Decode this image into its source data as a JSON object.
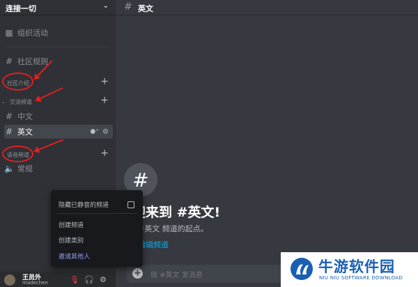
{
  "server": {
    "name": "连接一切"
  },
  "sidebar": {
    "events_label": "组织活动",
    "rules_channel": "社区规则",
    "categories": {
      "community": "社区介绍",
      "chat": "交流频道",
      "voice": "语音频道"
    },
    "chat_channels": [
      "中文",
      "英文"
    ],
    "voice_channel": "常规"
  },
  "channel_header": {
    "name": "英文"
  },
  "welcome": {
    "title": "迎来到 #英文!",
    "subtitle": "#英文 频道的起点。",
    "edit_link": "编辑频道"
  },
  "composer": {
    "placeholder": "给 #英文 发消息"
  },
  "context_menu": {
    "items": [
      "隐藏已静音的频道",
      "创建频道",
      "创建类别",
      "邀请其他人"
    ]
  },
  "user": {
    "name": "王员外",
    "tag": "madechen"
  },
  "watermark": {
    "title": "牛游软件园",
    "subtitle": "NIU NIU SOFTWARE DOWNLOAD"
  },
  "colors": {
    "background": "#36393f",
    "sidebar": "#2f3136",
    "accent_link": "#00aff4",
    "annotation": "#e02020"
  }
}
